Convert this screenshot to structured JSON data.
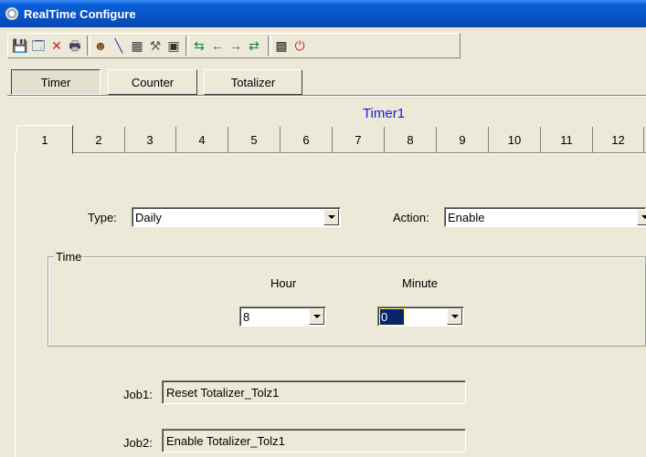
{
  "window": {
    "title": "RealTime Configure"
  },
  "toolbar": {
    "buttons": [
      {
        "name": "save-icon",
        "glyph": "💾",
        "color": "#1f3fa8"
      },
      {
        "name": "open-icon",
        "glyph": "🗔",
        "color": "#1f3fa8"
      },
      {
        "name": "delete-icon",
        "glyph": "✕",
        "color": "#d02020"
      },
      {
        "name": "print-icon",
        "glyph": "🖶",
        "color": "#404060"
      },
      {
        "name": "users-icon",
        "glyph": "☻",
        "color": "#805020"
      },
      {
        "name": "line-icon",
        "glyph": "╲",
        "color": "#2040a0"
      },
      {
        "name": "calc-icon",
        "glyph": "▦",
        "color": "#404040"
      },
      {
        "name": "tools-icon",
        "glyph": "⚒",
        "color": "#606060"
      },
      {
        "name": "page-icon",
        "glyph": "▣",
        "color": "#303030"
      },
      {
        "name": "first-icon",
        "glyph": "⇆",
        "color": "#108030"
      },
      {
        "name": "left-arrow-icon",
        "glyph": "←",
        "color": "#108030"
      },
      {
        "name": "right-arrow-icon",
        "glyph": "→",
        "color": "#108030"
      },
      {
        "name": "last-icon",
        "glyph": "⇄",
        "color": "#108030"
      },
      {
        "name": "chip-icon",
        "glyph": "▩",
        "color": "#303030"
      },
      {
        "name": "power-icon",
        "glyph": "⏻",
        "color": "#d02020"
      }
    ]
  },
  "category_tabs": [
    {
      "label": "Timer",
      "active": true
    },
    {
      "label": "Counter",
      "active": false
    },
    {
      "label": "Totalizer",
      "active": false
    }
  ],
  "heading": "Timer1",
  "number_tabs": [
    "1",
    "2",
    "3",
    "4",
    "5",
    "6",
    "7",
    "8",
    "9",
    "10",
    "11",
    "12"
  ],
  "active_number_tab": "1",
  "type": {
    "label": "Type:",
    "value": "Daily"
  },
  "action": {
    "label": "Action:",
    "value": "Enable"
  },
  "time_group": {
    "legend": "Time",
    "hour": {
      "label": "Hour",
      "value": "8"
    },
    "minute": {
      "label": "Minute",
      "value": "0"
    }
  },
  "jobs": [
    {
      "label": "Job1:",
      "value": "Reset Totalizer_Tolz1"
    },
    {
      "label": "Job2:",
      "value": "Enable Totalizer_Tolz1"
    }
  ],
  "colors": {
    "title_bar": "#0a5fd8",
    "heading": "#1a1ae0",
    "face": "#ece9d8",
    "selection": "#0a246a"
  }
}
